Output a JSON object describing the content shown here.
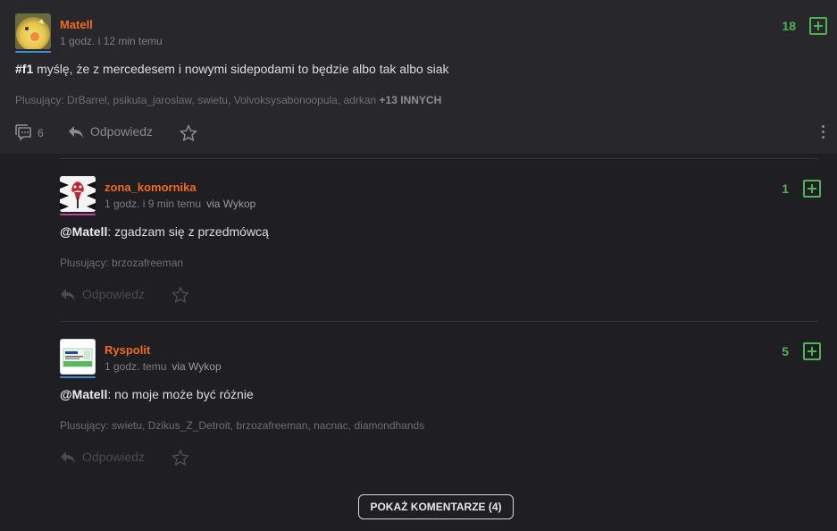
{
  "entry": {
    "author": "Matell",
    "time": "1 godz. i 12 min temu",
    "score": "18",
    "tag": "#f1",
    "text": " myślę, że z mercedesem i nowymi sidepodami to będzie albo tak albo siak",
    "voters_label": "Plusujący: DrBarrel, psikuta_jaroslaw, swietu, Volvoksysabonoopula, adrkan ",
    "voters_more": "+13 INNYCH",
    "comment_count": "6",
    "reply_label": "Odpowiedz",
    "underline_color": "#3d8fd1"
  },
  "comments": [
    {
      "author": "zona_komornika",
      "time": "1 godz. i 9 min temu",
      "via": "via Wykop",
      "score": "1",
      "mention": "@Matell",
      "text": ": zgadzam się z przedmówcą",
      "voters_label": "Plusujący: brzozafreeman",
      "reply_label": "Odpowiedz",
      "underline_color": "#c13ea1"
    },
    {
      "author": "Ryspolit",
      "time": "1 godz. temu",
      "via": "via Wykop",
      "score": "5",
      "mention": "@Matell",
      "text": ": no moje może być różnie",
      "voters_label": "Plusujący: swietu, Dzikus_Z_Detroit, brzozafreeman, nacnac, diamondhands",
      "reply_label": "Odpowiedz",
      "underline_color": "#3d8fd1",
      "avatar_text": "Ryspolit"
    }
  ],
  "show_comments_label": "POKAŻ KOMENTARZE (4)",
  "colors": {
    "username": "#f26b22",
    "score": "#4fb34f",
    "background": "#1f1e23",
    "entry_background": "#28272c"
  }
}
